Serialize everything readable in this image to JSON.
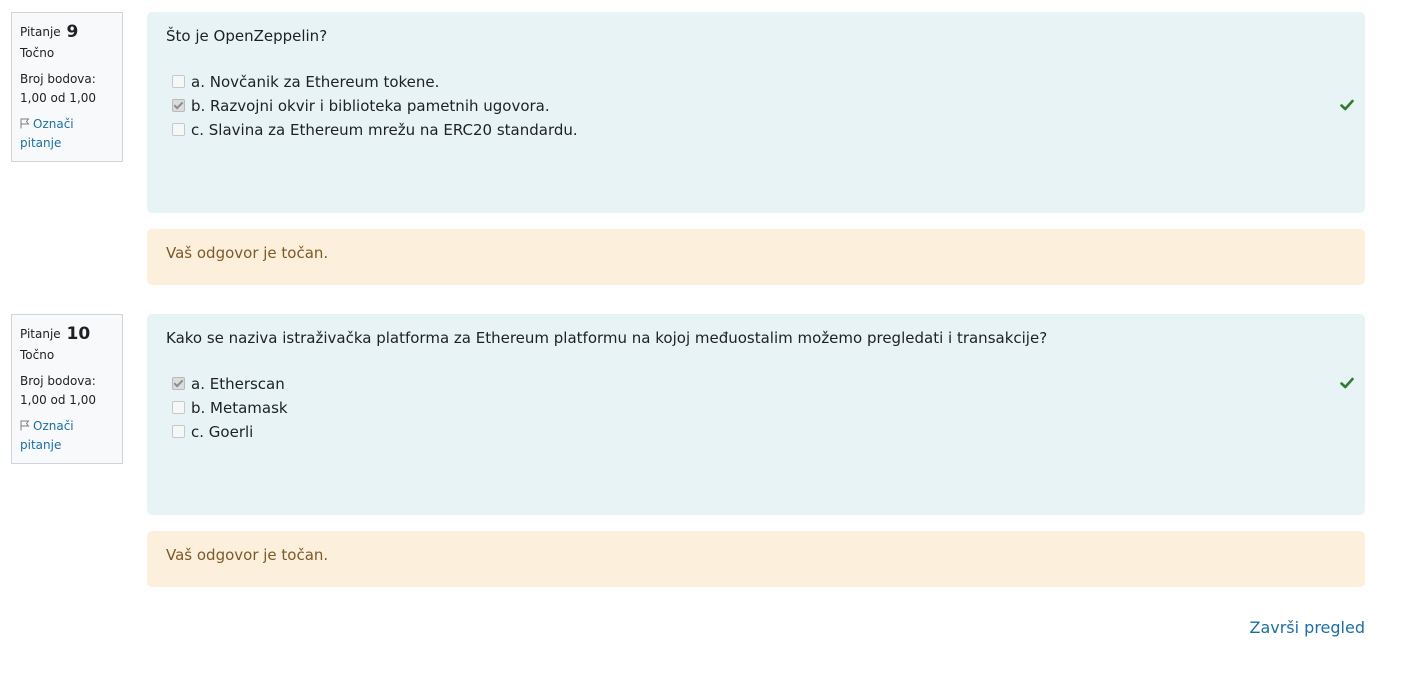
{
  "questions": [
    {
      "label": "Pitanje",
      "number": "9",
      "state": "Točno",
      "grade_label": "Broj bodova:",
      "grade_value": "1,00 od 1,00",
      "flag_label_1": "Označi",
      "flag_label_2": "pitanje",
      "text": "Što je OpenZeppelin?",
      "answers": [
        {
          "label": "a. Novčanik za Ethereum tokene.",
          "checked": false
        },
        {
          "label": "b. Razvojni okvir i biblioteka pametnih ugovora.",
          "checked": true
        },
        {
          "label": "c. Slavina za Ethereum mrežu na ERC20 standardu.",
          "checked": false
        }
      ],
      "correct_answer_index": 1,
      "feedback": "Vaš odgovor je točan."
    },
    {
      "label": "Pitanje",
      "number": "10",
      "state": "Točno",
      "grade_label": "Broj bodova:",
      "grade_value": "1,00 od 1,00",
      "flag_label_1": "Označi",
      "flag_label_2": "pitanje",
      "text": "Kako se naziva istraživačka platforma za Ethereum platformu na kojoj međuostalim možemo pregledati i transakcije?",
      "answers": [
        {
          "label": "a. Etherscan",
          "checked": true
        },
        {
          "label": "b. Metamask",
          "checked": false
        },
        {
          "label": "c. Goerli",
          "checked": false
        }
      ],
      "correct_answer_index": 0,
      "feedback": "Vaš odgovor je točan."
    }
  ],
  "finish_review": "Završi pregled",
  "colors": {
    "formulation_bg": "#e7f3f5",
    "feedback_bg": "#fcefdc",
    "feedback_text": "#7d5a29",
    "link": "#1c6fa5",
    "correct_tick": "#357a32"
  },
  "icons": {
    "flag": "flag-icon",
    "correct": "check-icon"
  }
}
